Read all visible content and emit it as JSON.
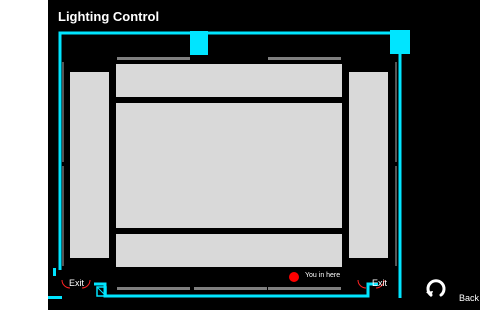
{
  "app": {
    "title": "Lighting Control"
  },
  "floor_plan": {
    "exits": [
      "Exit",
      "Exit"
    ],
    "location_marker": {
      "label": "You in here"
    }
  },
  "navigation": {
    "back_label": "Back",
    "back_icon": "rotate-arrow-icon"
  },
  "colors": {
    "background": "#000000",
    "walls": "#00e5ff",
    "rooms": "#d9d9d9",
    "marker": "#ff0000"
  }
}
